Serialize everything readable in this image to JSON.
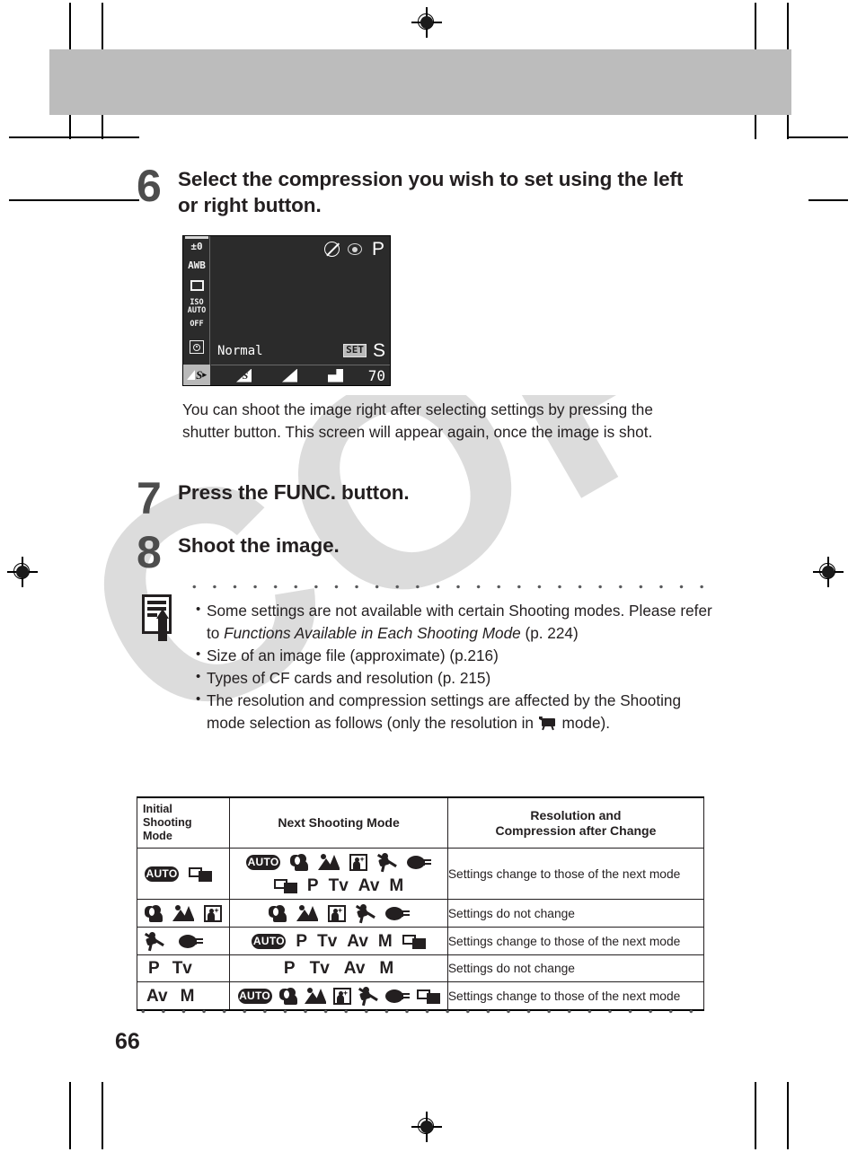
{
  "page": {
    "number": "66"
  },
  "steps": [
    {
      "num": "6",
      "title": "Select the compression you wish to set using the left or right button."
    },
    {
      "num": "7",
      "title_before": "Press the ",
      "title_button": "FUNC.",
      "title_after": " button."
    },
    {
      "num": "8",
      "title": "Shoot the image."
    }
  ],
  "body_text": "You can shoot the image right after selecting settings by pressing the shutter button.  This screen will appear again, once the image is shot.",
  "lcd": {
    "exposure": "±0",
    "white_balance": "AWB",
    "drive_icon": "single-shot-square",
    "iso_line1": "ISO",
    "iso_line2": "AUTO",
    "flash_line": "OFF",
    "metering_icon": "evaluative-metering-icon",
    "selected_rail_icon": "compression-icon",
    "top_icons": [
      "flash-off-icon",
      "red-eye-icon"
    ],
    "shooting_mode": "P",
    "compression_label": "Normal",
    "set_badge": "SET",
    "resolution": "S",
    "shots_remaining": "70",
    "compression_options": [
      "superfine-icon",
      "fine-icon",
      "normal-icon"
    ]
  },
  "notes": {
    "icon": "note-pencil-icon",
    "items": [
      {
        "parts": [
          {
            "text": "Some settings are not available with certain Shooting modes.  Please refer to ",
            "style": "normal"
          },
          {
            "text": "Functions Available in Each Shooting Mode",
            "style": "italic"
          },
          {
            "text": " (p. 224)",
            "style": "normal"
          }
        ]
      },
      {
        "parts": [
          {
            "text": "Size of an image file (approximate) (p.216)",
            "style": "normal"
          }
        ]
      },
      {
        "parts": [
          {
            "text": "Types of CF cards and resolution (p. 215)",
            "style": "normal"
          }
        ]
      },
      {
        "parts": [
          {
            "text": "The resolution and compression settings are affected by the Shooting mode selection as follows (only the resolution in ",
            "style": "normal"
          },
          {
            "text": "movie-mode-icon",
            "style": "icon"
          },
          {
            "text": " mode).",
            "style": "normal"
          }
        ]
      }
    ]
  },
  "table": {
    "headers": {
      "col1": "Initial Shooting Mode",
      "col2": "Next Shooting Mode",
      "col3_line1": "Resolution and",
      "col3_line2": "Compression after Change"
    },
    "rows": [
      {
        "initial": [
          "auto",
          "stitch"
        ],
        "next": [
          "auto",
          "portrait",
          "landscape",
          "night",
          "sports",
          "macro",
          "stitch",
          "P",
          "Tv",
          "Av",
          "M"
        ],
        "result": "Settings change to those of the next mode"
      },
      {
        "initial": [
          "portrait",
          "landscape",
          "night"
        ],
        "next": [
          "portrait",
          "landscape",
          "night",
          "sports",
          "macro"
        ],
        "result": "Settings do not change"
      },
      {
        "initial": [
          "sports",
          "macro"
        ],
        "next": [
          "auto",
          "P",
          "Tv",
          "Av",
          "M",
          "stitch"
        ],
        "result": "Settings change to those of the next mode"
      },
      {
        "initial": [
          "P",
          "Tv"
        ],
        "next": [
          "P",
          "Tv",
          "Av",
          "M"
        ],
        "result": "Settings do not change"
      },
      {
        "initial": [
          "Av",
          "M"
        ],
        "next": [
          "auto",
          "portrait",
          "landscape",
          "night",
          "sports",
          "macro",
          "stitch"
        ],
        "result": "Settings change to those of the next mode"
      }
    ]
  },
  "watermark": {
    "text": "COPY",
    "color": "#dcdcdc"
  },
  "colors": {
    "header_band": "#bcbcbc",
    "step_number": "#4d4d4d",
    "text": "#231f20",
    "lcd_background": "#2b2b2b"
  }
}
